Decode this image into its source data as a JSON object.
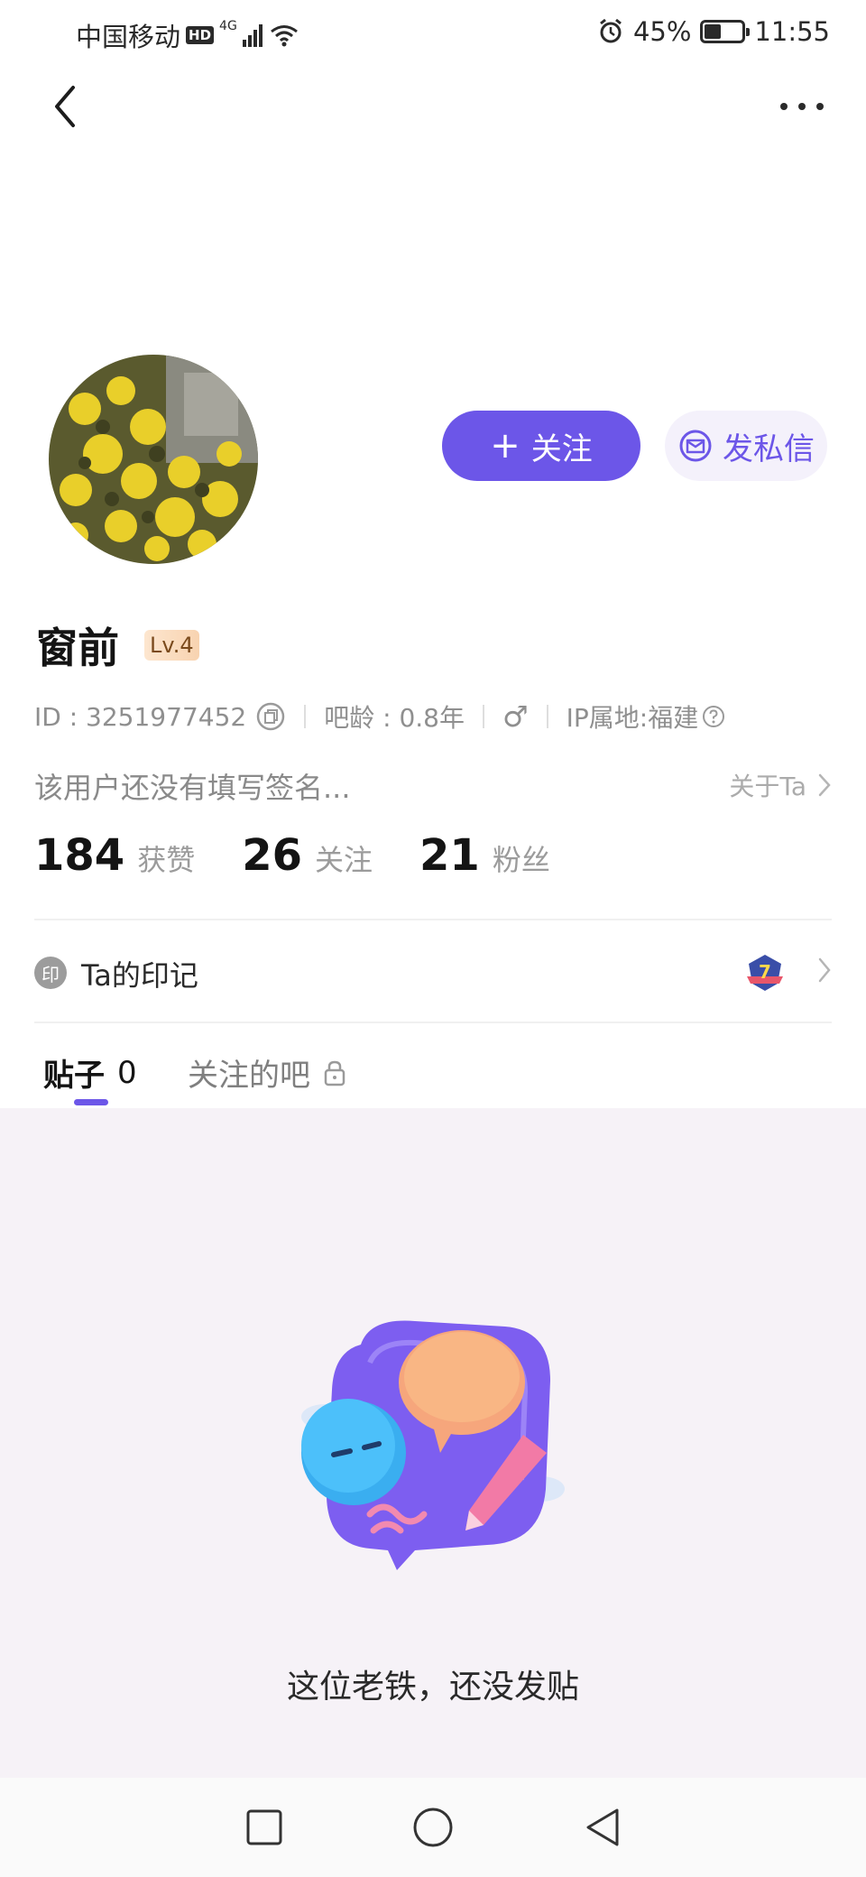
{
  "status_bar": {
    "carrier": "中国移动",
    "hd": "HD",
    "network": "4G",
    "battery_percent": "45%",
    "battery_level": 0.45,
    "time": "11:55"
  },
  "profile": {
    "username": "窗前",
    "level": "Lv.4",
    "id_text": "ID : 3251977452",
    "tieba_age": "吧龄 : 0.8年",
    "gender_symbol": "♂",
    "ip_location": "IP属地:福建",
    "bio": "该用户还没有填写签名...",
    "about_label": "关于Ta"
  },
  "actions": {
    "follow_plus": "+",
    "follow_label": "关注",
    "message_label": "发私信"
  },
  "stats": [
    {
      "value": "184",
      "label": "获赞"
    },
    {
      "value": "26",
      "label": "关注"
    },
    {
      "value": "21",
      "label": "粉丝"
    }
  ],
  "imprint": {
    "icon_char": "印",
    "label": "Ta的印记",
    "badge_number": "7"
  },
  "tabs": {
    "posts_label": "贴子",
    "posts_count": "0",
    "followed_bars_label": "关注的吧"
  },
  "empty_state": {
    "message": "这位老铁，还没发贴"
  },
  "colors": {
    "accent": "#6c56e8",
    "empty_bg": "#f6f2f7"
  }
}
